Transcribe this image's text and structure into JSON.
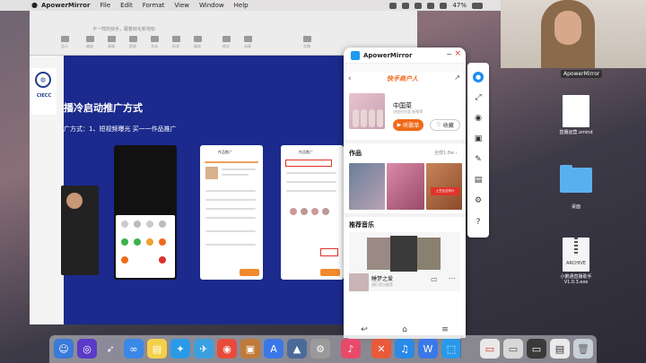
{
  "menubar": {
    "app_name": "ApowerMirror",
    "items": [
      "File",
      "Edit",
      "Format",
      "View",
      "Window",
      "Help"
    ],
    "battery": "47%"
  },
  "keynote": {
    "doc_title": "不一样的快手，跟着转化新地标",
    "toolbar_labels": [
      "显示",
      "缩放",
      "表格",
      "图表",
      "文本",
      "形状",
      "媒体",
      "格式",
      "动画",
      "文稿"
    ],
    "logo_text": "CIECC",
    "slide_title": "播冷启动推广方式",
    "slide_subtitle": "广方式：1、短视频曝光      买一一作品推广",
    "phone_c_header": "作品推广",
    "phone_d_header": "作品推广"
  },
  "mirror": {
    "title": "ApowerMirror",
    "brand": "快手商户人",
    "album_name": "中国菜",
    "album_meta": "讲述时光里 新推荐",
    "listen_label": "听歌单",
    "fav_label": "收藏",
    "works_title": "作品",
    "works_more": "全部1.8w ›",
    "work_tag_text": "土豆丝这样炒",
    "music_title": "推荐音乐",
    "song_name": "睡梦之爱",
    "song_artist": "流行音乐推荐"
  },
  "webcam": {
    "label": "ApowerMirror"
  },
  "desktop": {
    "file1": "直播运营.xmind",
    "folder": "桌面",
    "archive_text": "ARCHIVE",
    "archive": "小鹅通直播助手\nV1.0.3.exe"
  },
  "icons": {
    "user": "user-icon",
    "resize": "expand-icon",
    "camera": "screenshot-icon",
    "record": "record-icon",
    "pen": "pen-icon",
    "gift": "toolbox-icon",
    "settings": "gear-icon",
    "help": "help-icon"
  }
}
